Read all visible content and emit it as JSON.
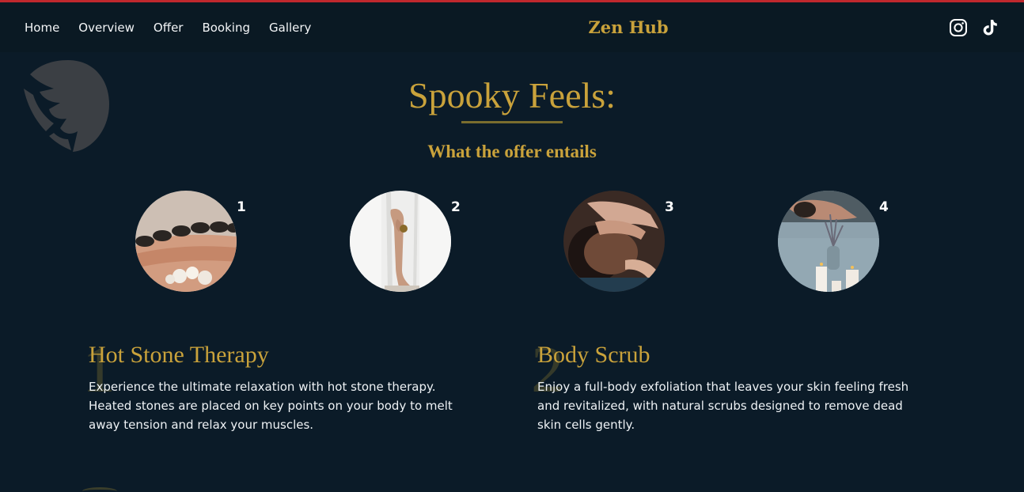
{
  "nav": {
    "links": [
      "Home",
      "Overview",
      "Offer",
      "Booking",
      "Gallery"
    ],
    "brand": "Zen Hub",
    "social": [
      "instagram-icon",
      "tiktok-icon"
    ]
  },
  "section": {
    "title": "Spooky Feels:",
    "subtitle": "What the offer entails"
  },
  "steps": [
    {
      "number": "1",
      "image": "hot-stones-on-back"
    },
    {
      "number": "2",
      "image": "leg-behind-curtain"
    },
    {
      "number": "3",
      "image": "facial-massage"
    },
    {
      "number": "4",
      "image": "spa-candles-lavender"
    }
  ],
  "services": [
    {
      "number": "1",
      "title": "Hot Stone Therapy",
      "description": "Experience the ultimate relaxation with hot stone therapy. Heated stones are placed on key points on your body to melt away tension and relax your muscles."
    },
    {
      "number": "2",
      "title": "Body Scrub",
      "description": "Enjoy a full-body exfoliation that leaves your skin feeling fresh and revitalized, with natural scrubs designed to remove dead skin cells gently."
    }
  ],
  "colors": {
    "background": "#0b1b28",
    "accent": "#c9a23b",
    "topbar": "#c0282d"
  }
}
